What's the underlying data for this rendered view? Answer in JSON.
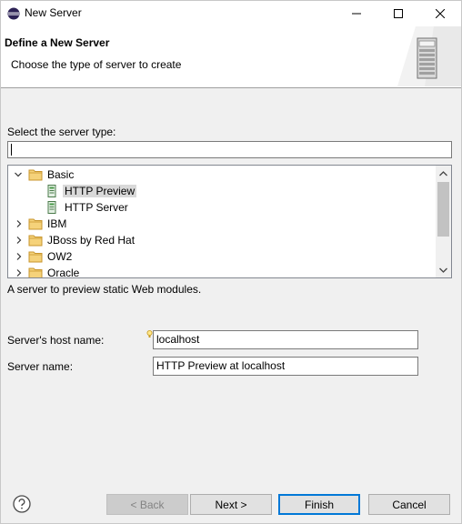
{
  "window": {
    "title": "New Server"
  },
  "header": {
    "title": "Define a New Server",
    "description": "Choose the type of server to create"
  },
  "form": {
    "select_type_label": "Select the server type:",
    "filter_value": "",
    "tree": [
      {
        "label": "Basic",
        "type": "folder",
        "expanded": true
      },
      {
        "label": "HTTP Preview",
        "type": "server",
        "selected": true
      },
      {
        "label": "HTTP Server",
        "type": "server"
      },
      {
        "label": "IBM",
        "type": "folder",
        "expanded": false
      },
      {
        "label": "JBoss by Red Hat",
        "type": "folder",
        "expanded": false
      },
      {
        "label": "OW2",
        "type": "folder",
        "expanded": false
      },
      {
        "label": "Oracle",
        "type": "folder",
        "expanded": false
      }
    ],
    "type_description": "A server to preview static Web modules.",
    "host_label": "Server's host name:",
    "host_value": "localhost",
    "name_label": "Server name:",
    "name_value": "HTTP Preview at localhost"
  },
  "buttons": {
    "back": "< Back",
    "next": "Next >",
    "finish": "Finish",
    "cancel": "Cancel"
  },
  "icons": {
    "app": "eclipse-icon",
    "minimize": "minimize-icon",
    "maximize": "maximize-icon",
    "close": "close-icon",
    "help": "help-icon",
    "folder": "folder-icon",
    "server": "server-icon"
  },
  "colors": {
    "folder": "#e8b84a",
    "server_icon": "#4a9a4a",
    "selection": "#d9d9d9",
    "default_button_border": "#0078d7"
  }
}
